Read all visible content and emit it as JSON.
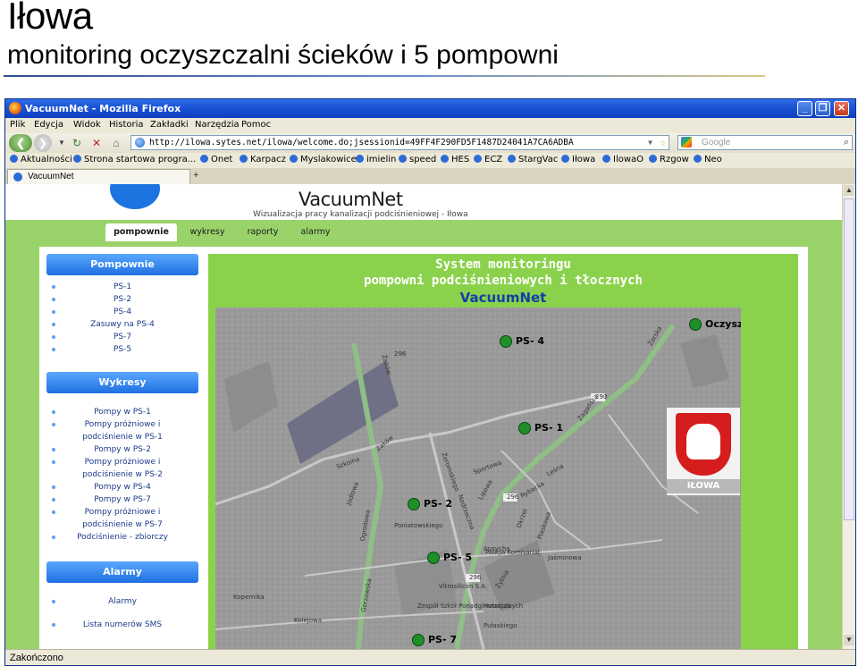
{
  "slide": {
    "title": "Iłowa",
    "subtitle": "monitoring oczyszczalni ścieków i 5 pompowni"
  },
  "browser": {
    "window_title": "VacuumNet - Mozilla Firefox",
    "menu": [
      "Plik",
      "Edycja",
      "Widok",
      "Historia",
      "Zakładki",
      "Narzędzia",
      "Pomoc"
    ],
    "url": "http://ilowa.sytes.net/ilowa/welcome.do;jsessionid=49FF4F290FD5F1487D24041A7CA6ADBA",
    "search_placeholder": "Google",
    "bookmarks": [
      "Aktualności",
      "Strona startowa progra...",
      "Onet",
      "Karpacz",
      "Myslakowice",
      "imielin",
      "speed",
      "HES",
      "ECZ",
      "StargVac",
      "Iłowa",
      "IlowaO",
      "Rzgow",
      "Neo"
    ],
    "tab_label": "VacuumNet",
    "status": "Zakończono"
  },
  "site": {
    "title": "VacuumNet",
    "subtitle": "Wizualizacja pracy kanalizacji podciśnieniowej - Iłowa",
    "tabs": [
      "pompownie",
      "wykresy",
      "raporty",
      "alarmy"
    ],
    "active_tab": "pompownie"
  },
  "sidebar": {
    "pompownie_head": "Pompownie",
    "pompownie": [
      "PS-1",
      "PS-2",
      "PS-4",
      "Zasuwy na PS-4",
      "PS-7",
      "PS-5"
    ],
    "wykresy_head": "Wykresy",
    "wykresy": [
      "Pompy w PS-1",
      "Pompy próżniowe i",
      "podciśnienie w PS-1",
      "Pompy w PS-2",
      "Pompy próżniowe i",
      "podciśnienie w PS-2",
      "Pompy w PS-4",
      "Pompy w PS-7",
      "Pompy próżniowe i",
      "podciśnienie w PS-7",
      "Podciśnienie - zbiorczy"
    ],
    "alarmy_head": "Alarmy",
    "alarmy": [
      "Alarmy",
      "Lista numerów SMS"
    ]
  },
  "main": {
    "title_line1": "System monitoringu",
    "title_line2": "pompowni podciśnieniowych i tłocznych",
    "brand": "VacuumNet",
    "markers": [
      "Oczyszczalnia",
      "PS- 4",
      "PS- 1",
      "PS- 2",
      "PS- 5",
      "PS- 7"
    ],
    "coat_label": "IŁOWA",
    "streets": [
      "Żarska",
      "Żagańska",
      "Żaków",
      "Zaków",
      "Sportowa",
      "Szkolna",
      "Lipowa",
      "Żeromskiego",
      "Leśna",
      "Rybacka",
      "Ogrodowa",
      "Nadrzeczna",
      "Żytnia",
      "Okrzei",
      "Piaskowa",
      "Jaśminowa",
      "Policja Komisariat",
      "Vitrosilicon S.A.",
      "Zespół Szkół Ponadgimnazjalnych",
      "Hutnicza",
      "Kolejowa",
      "Pułaskiego",
      "Asnycha",
      "Jodłowa",
      "Gorzowska",
      "Kopernika",
      "Poniatowskiego"
    ],
    "road_numbers": [
      "290",
      "296",
      "296",
      "296"
    ]
  }
}
